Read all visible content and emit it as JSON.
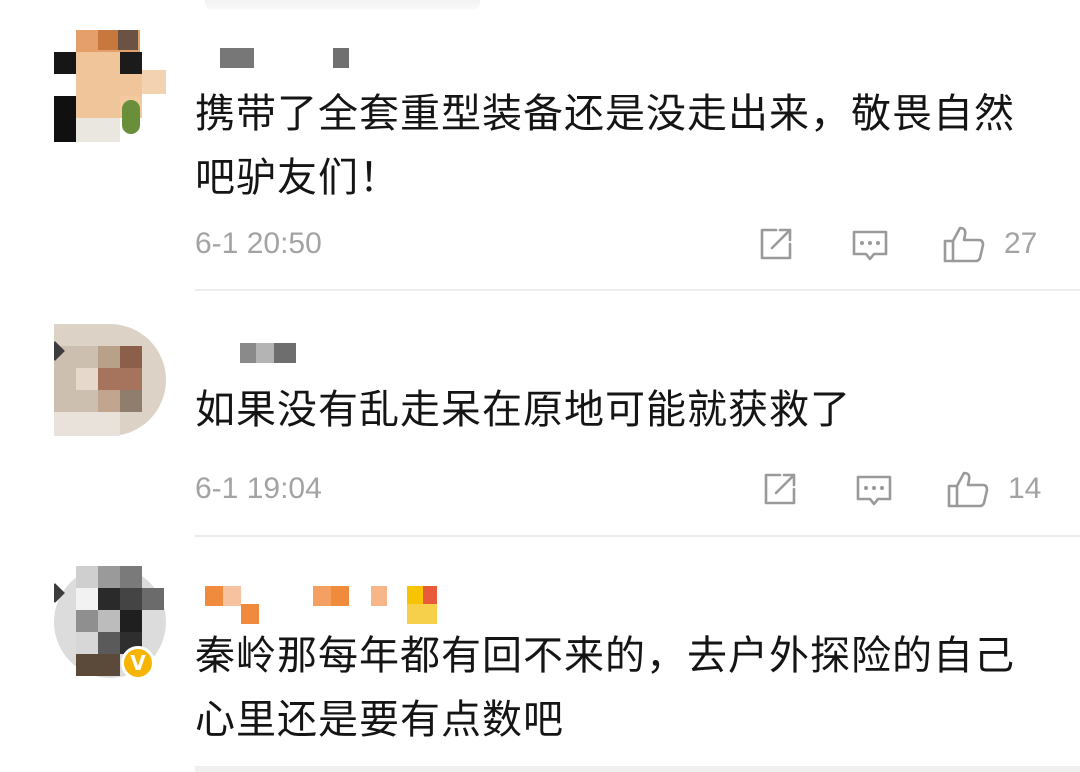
{
  "comments": [
    {
      "text": "携带了全套重型装备还是没走出来，敬畏自然吧驴友们！",
      "time": "6-1 20:50",
      "likes": "27",
      "avatar_colors": [
        "#d8874a",
        "#f1c59a",
        "#1b1b1b",
        "#6a8f3a",
        "#eae6e0"
      ]
    },
    {
      "text": "如果没有乱走呆在原地可能就获救了",
      "time": "6-1 19:04",
      "likes": "14",
      "avatar_colors": [
        "#c6b7a5",
        "#a6745c",
        "#e6d9cb",
        "#8f7e6e"
      ]
    },
    {
      "text": "秦岭那每年都有回不来的，去户外探险的自己心里还是要有点数吧",
      "verified_badge": "V",
      "avatar_colors": [
        "#2a2a2a",
        "#7a7a7a",
        "#cfcfcf",
        "#5b4a3a"
      ],
      "name_colors": [
        "#f08a3c",
        "#f7c2a0",
        "#f6c400",
        "#e85a3a"
      ]
    }
  ],
  "icons": [
    "share-icon",
    "comment-icon",
    "like-icon"
  ],
  "colors": {
    "meta_text": "#a3a3a3",
    "divider": "#ececec",
    "badge": "#f6b500"
  }
}
